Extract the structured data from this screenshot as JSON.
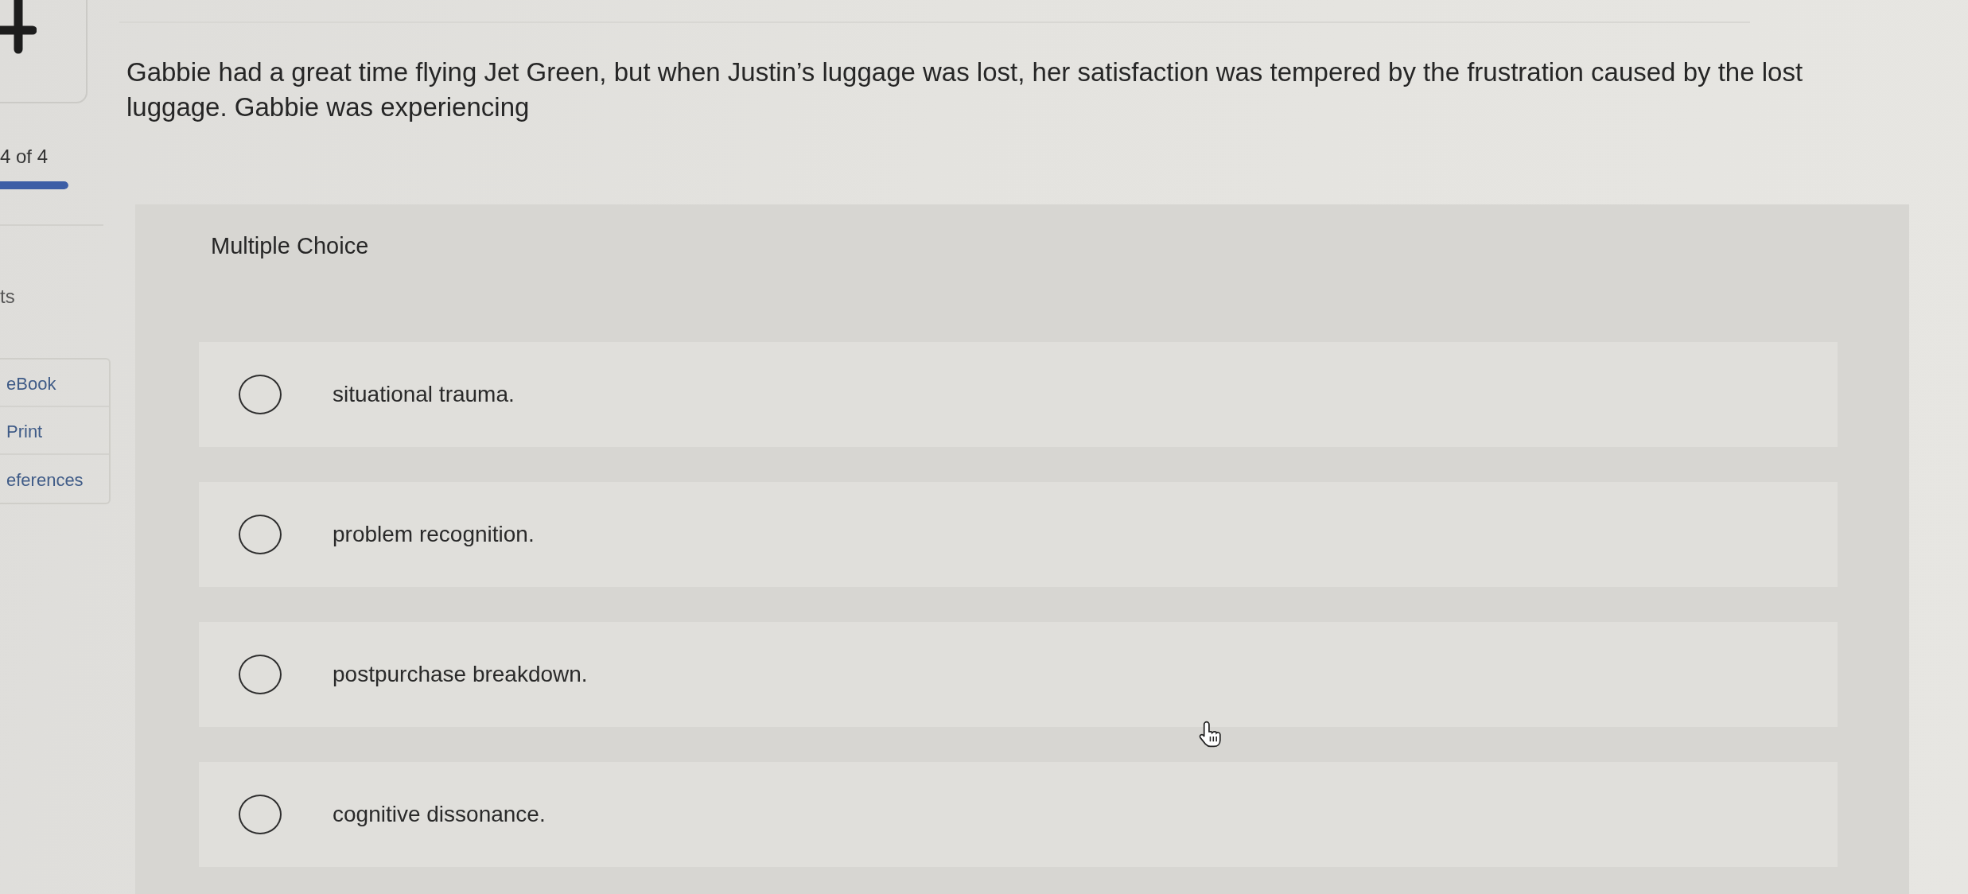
{
  "sidebar": {
    "counter": "4 of 4",
    "progress": {
      "level": 1
    },
    "label": "ts",
    "links": [
      {
        "label": "eBook"
      },
      {
        "label": "Print"
      },
      {
        "label": "eferences"
      }
    ]
  },
  "question": {
    "text": "Gabbie had a great time flying Jet Green, but when Justin’s luggage was lost, her satisfaction was tempered by the frustration caused by the lost luggage. Gabbie was experiencing",
    "type": "Multiple Choice",
    "options": [
      {
        "label": "situational trauma.",
        "selected": false
      },
      {
        "label": "problem recognition.",
        "selected": false
      },
      {
        "label": "postpurchase breakdown.",
        "selected": false
      },
      {
        "label": "cognitive dissonance.",
        "selected": false
      }
    ]
  }
}
